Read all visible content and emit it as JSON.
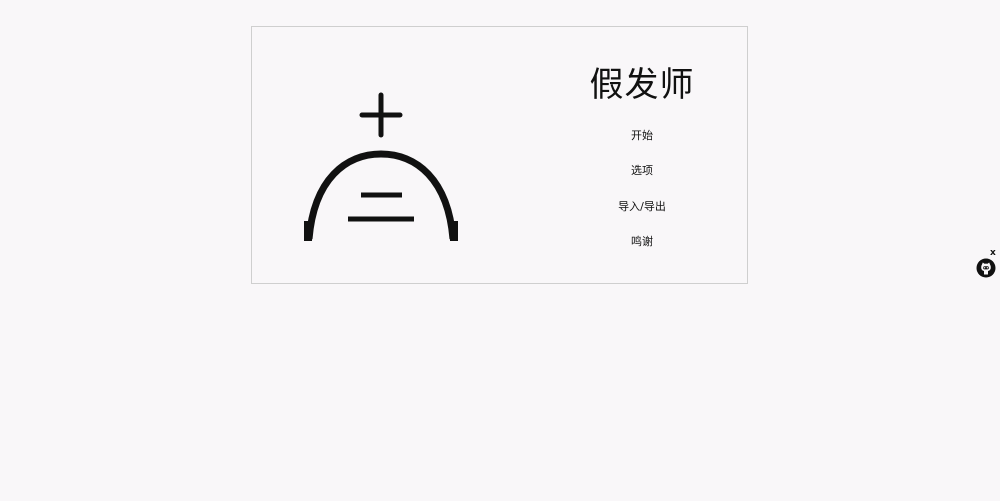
{
  "title": "假发师",
  "menu": [
    {
      "label": "开始"
    },
    {
      "label": "选项"
    },
    {
      "label": "导入/导出"
    },
    {
      "label": "鸣谢"
    }
  ],
  "side_widget": {
    "close_label": "x",
    "icon": "github-octocat-icon"
  },
  "logo_icon": "wig-dome-logo-icon"
}
